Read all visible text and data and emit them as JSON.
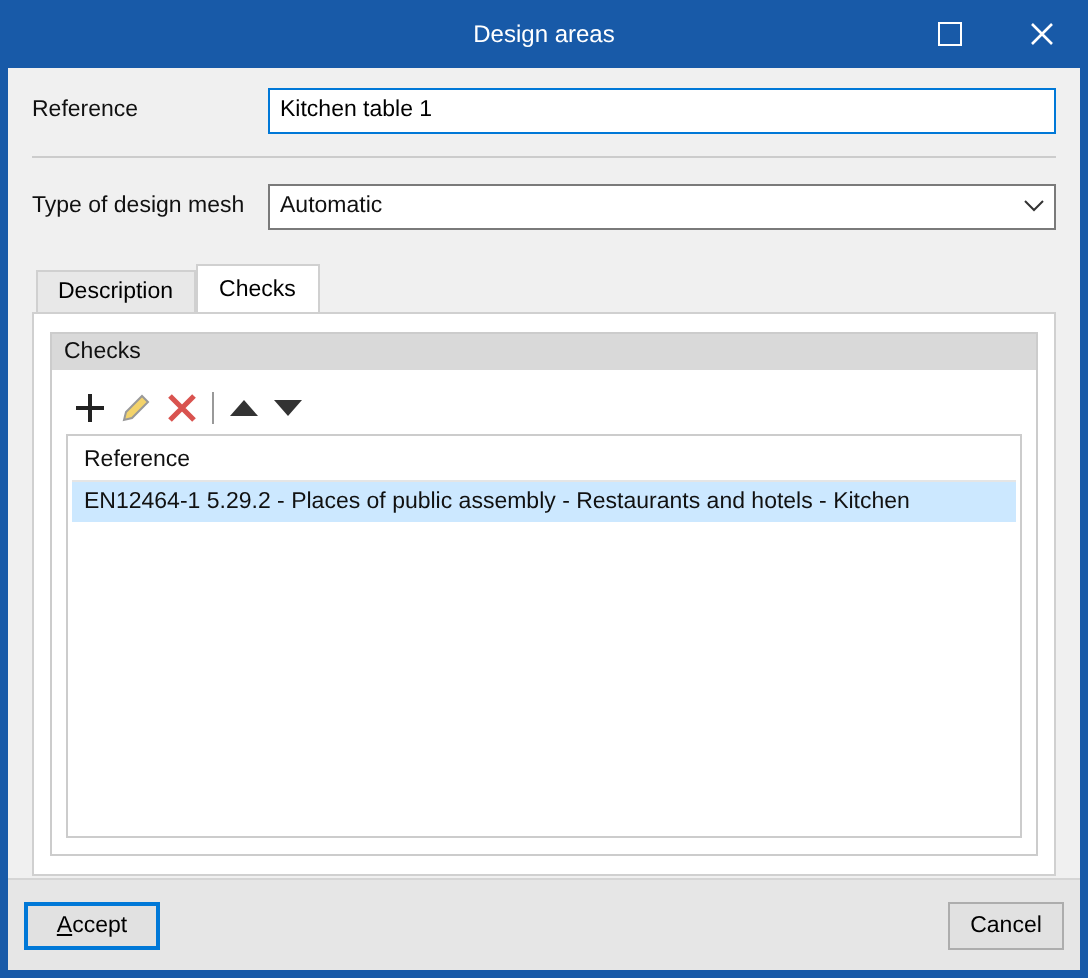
{
  "window": {
    "title": "Design areas"
  },
  "reference": {
    "label": "Reference",
    "value": "Kitchen table 1"
  },
  "mesh_type": {
    "label": "Type of design mesh",
    "value": "Automatic"
  },
  "tabs": [
    {
      "label": "Description",
      "selected": false
    },
    {
      "label": "Checks",
      "selected": true
    }
  ],
  "checks": {
    "title": "Checks",
    "columns": [
      "Reference"
    ],
    "rows": [
      {
        "cells": [
          "EN12464-1 5.29.2 - Places of public assembly - Restaurants and hotels - Kitchen"
        ],
        "selected": true
      }
    ]
  },
  "buttons": [
    {
      "label": "Accept",
      "default": true,
      "underline_first": true
    },
    {
      "label": "Cancel",
      "default": false,
      "underline_first": false
    }
  ]
}
